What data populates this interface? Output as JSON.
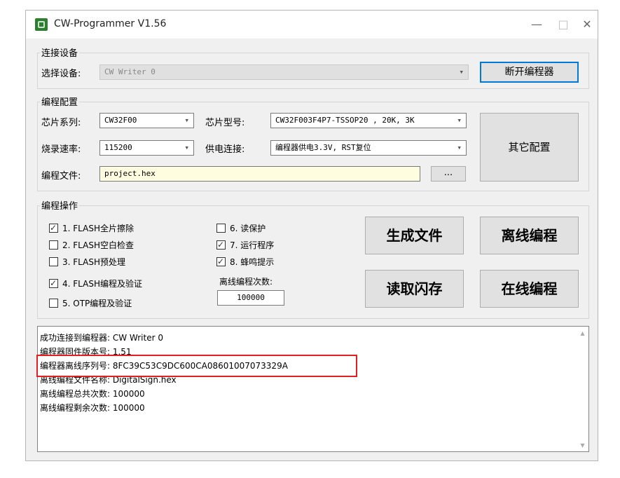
{
  "window": {
    "title": "CW-Programmer V1.56",
    "minimize": "—",
    "maximize": "□",
    "close": "✕"
  },
  "connect": {
    "group_label": "连接设备",
    "device_label": "选择设备:",
    "device_value": "CW Writer 0",
    "disconnect_button": "断开编程器"
  },
  "config": {
    "group_label": "编程配置",
    "series_label": "芯片系列:",
    "series_value": "CW32F00",
    "model_label": "芯片型号:",
    "model_value": "CW32F003F4P7-TSSOP20 , 20K, 3K",
    "rate_label": "烧录速率:",
    "rate_value": "115200",
    "power_label": "供电连接:",
    "power_value": "编程器供电3.3V, RST复位",
    "file_label": "编程文件:",
    "file_value": "project.hex",
    "browse_button": "...",
    "other_button": "其它配置"
  },
  "ops": {
    "group_label": "编程操作",
    "checks": [
      {
        "label": "1. FLASH全片擦除",
        "checked": true
      },
      {
        "label": "2. FLASH空白检查",
        "checked": false
      },
      {
        "label": "3. FLASH预处理",
        "checked": false
      },
      {
        "label": "4. FLASH编程及验证",
        "checked": true
      },
      {
        "label": "5. OTP编程及验证",
        "checked": false
      },
      {
        "label": "6. 读保护",
        "checked": false
      },
      {
        "label": "7. 运行程序",
        "checked": true
      },
      {
        "label": "8. 蜂鸣提示",
        "checked": true
      }
    ],
    "offline_count_label": "离线编程次数:",
    "offline_count_value": "100000",
    "gen_file_button": "生成文件",
    "offline_prog_button": "离线编程",
    "read_flash_button": "读取闪存",
    "online_prog_button": "在线编程"
  },
  "log": {
    "lines": [
      "成功连接到编程器: CW Writer 0",
      "编程器固件版本号: 1.51",
      "编程器离线序列号: 8FC39C53C9DC600CA08601007073329A",
      "离线编程文件名称: DigitalSign.hex",
      "离线编程总共次数: 100000",
      "离线编程剩余次数: 100000"
    ]
  },
  "icons": {
    "dropdown": "▾",
    "scroll_up": "▴",
    "scroll_down": "▾"
  }
}
